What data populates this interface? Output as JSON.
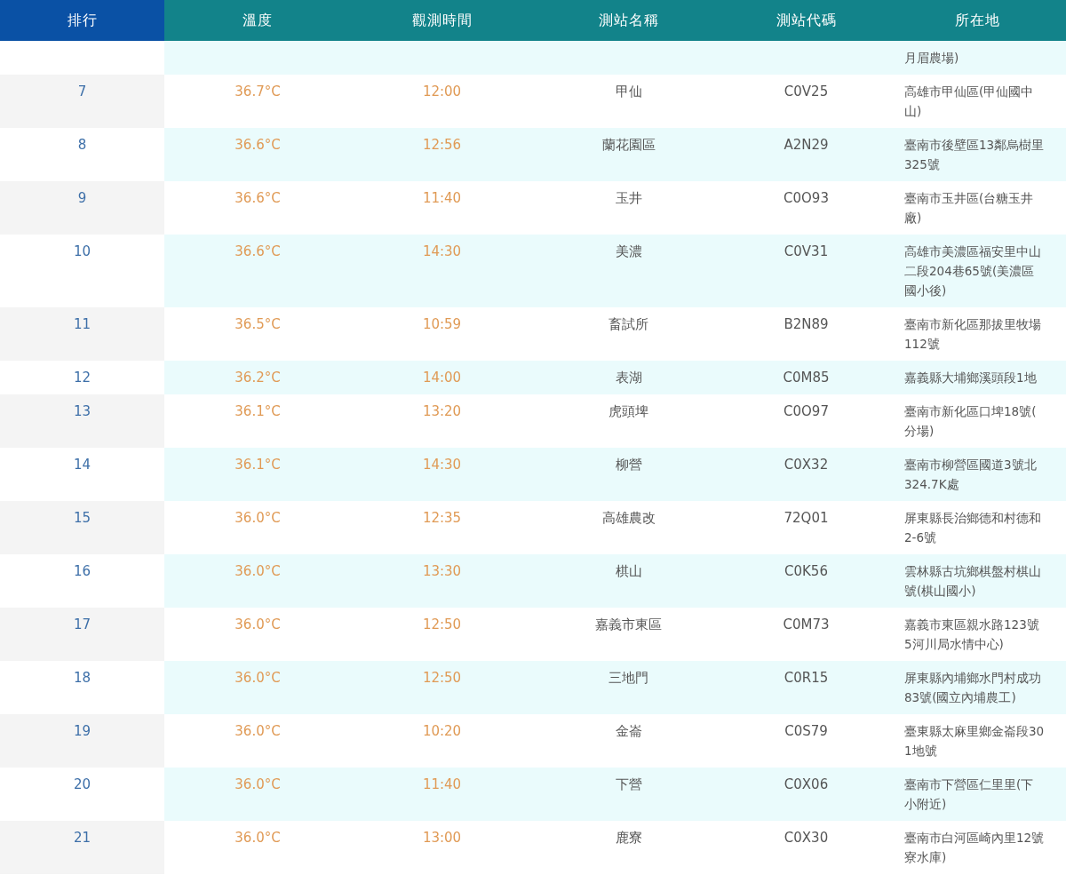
{
  "table": {
    "columns": [
      "排行",
      "溫度",
      "觀測時間",
      "測站名稱",
      "測站代碼",
      "所在地"
    ],
    "rows": [
      {
        "rank": "",
        "temperature": "",
        "time": "",
        "station": "",
        "code": "",
        "location": [
          "月眉農場)"
        ]
      },
      {
        "rank": "7",
        "temperature": "36.7°C",
        "time": "12:00",
        "station": "甲仙",
        "code": "C0V25",
        "location": [
          "高雄市甲仙區(甲仙國中",
          "山)"
        ]
      },
      {
        "rank": "8",
        "temperature": "36.6°C",
        "time": "12:56",
        "station": "蘭花園區",
        "code": "A2N29",
        "location": [
          "臺南市後壁區13鄰烏樹里",
          "325號"
        ]
      },
      {
        "rank": "9",
        "temperature": "36.6°C",
        "time": "11:40",
        "station": "玉井",
        "code": "C0O93",
        "location": [
          "臺南市玉井區(台糖玉井",
          "廠)"
        ]
      },
      {
        "rank": "10",
        "temperature": "36.6°C",
        "time": "14:30",
        "station": "美濃",
        "code": "C0V31",
        "location": [
          "高雄市美濃區福安里中山",
          "二段204巷65號(美濃區",
          "國小後)"
        ]
      },
      {
        "rank": "11",
        "temperature": "36.5°C",
        "time": "10:59",
        "station": "畜試所",
        "code": "B2N89",
        "location": [
          "臺南市新化區那拔里牧場",
          "112號"
        ]
      },
      {
        "rank": "12",
        "temperature": "36.2°C",
        "time": "14:00",
        "station": "表湖",
        "code": "C0M85",
        "location": [
          "嘉義縣大埔鄉溪頭段1地"
        ]
      },
      {
        "rank": "13",
        "temperature": "36.1°C",
        "time": "13:20",
        "station": "虎頭埤",
        "code": "C0O97",
        "location": [
          "臺南市新化區口埤18號(",
          "分場)"
        ]
      },
      {
        "rank": "14",
        "temperature": "36.1°C",
        "time": "14:30",
        "station": "柳營",
        "code": "C0X32",
        "location": [
          "臺南市柳營區國道3號北",
          "324.7K處"
        ]
      },
      {
        "rank": "15",
        "temperature": "36.0°C",
        "time": "12:35",
        "station": "高雄農改",
        "code": "72Q01",
        "location": [
          "屏東縣長治鄉德和村德和",
          "2-6號"
        ]
      },
      {
        "rank": "16",
        "temperature": "36.0°C",
        "time": "13:30",
        "station": "棋山",
        "code": "C0K56",
        "location": [
          "雲林縣古坑鄉棋盤村棋山",
          "號(棋山國小)"
        ]
      },
      {
        "rank": "17",
        "temperature": "36.0°C",
        "time": "12:50",
        "station": "嘉義市東區",
        "code": "C0M73",
        "location": [
          "嘉義市東區親水路123號",
          "5河川局水情中心)"
        ]
      },
      {
        "rank": "18",
        "temperature": "36.0°C",
        "time": "12:50",
        "station": "三地門",
        "code": "C0R15",
        "location": [
          "屏東縣內埔鄉水門村成功",
          "83號(國立內埔農工)"
        ]
      },
      {
        "rank": "19",
        "temperature": "36.0°C",
        "time": "10:20",
        "station": "金崙",
        "code": "C0S79",
        "location": [
          "臺東縣太麻里鄉金崙段30",
          "1地號"
        ]
      },
      {
        "rank": "20",
        "temperature": "36.0°C",
        "time": "11:40",
        "station": "下營",
        "code": "C0X06",
        "location": [
          "臺南市下營區仁里里(下",
          "小附近)"
        ]
      },
      {
        "rank": "21",
        "temperature": "36.0°C",
        "time": "13:00",
        "station": "鹿寮",
        "code": "C0X30",
        "location": [
          "臺南市白河區崎內里12號",
          "寮水庫)"
        ]
      }
    ]
  }
}
